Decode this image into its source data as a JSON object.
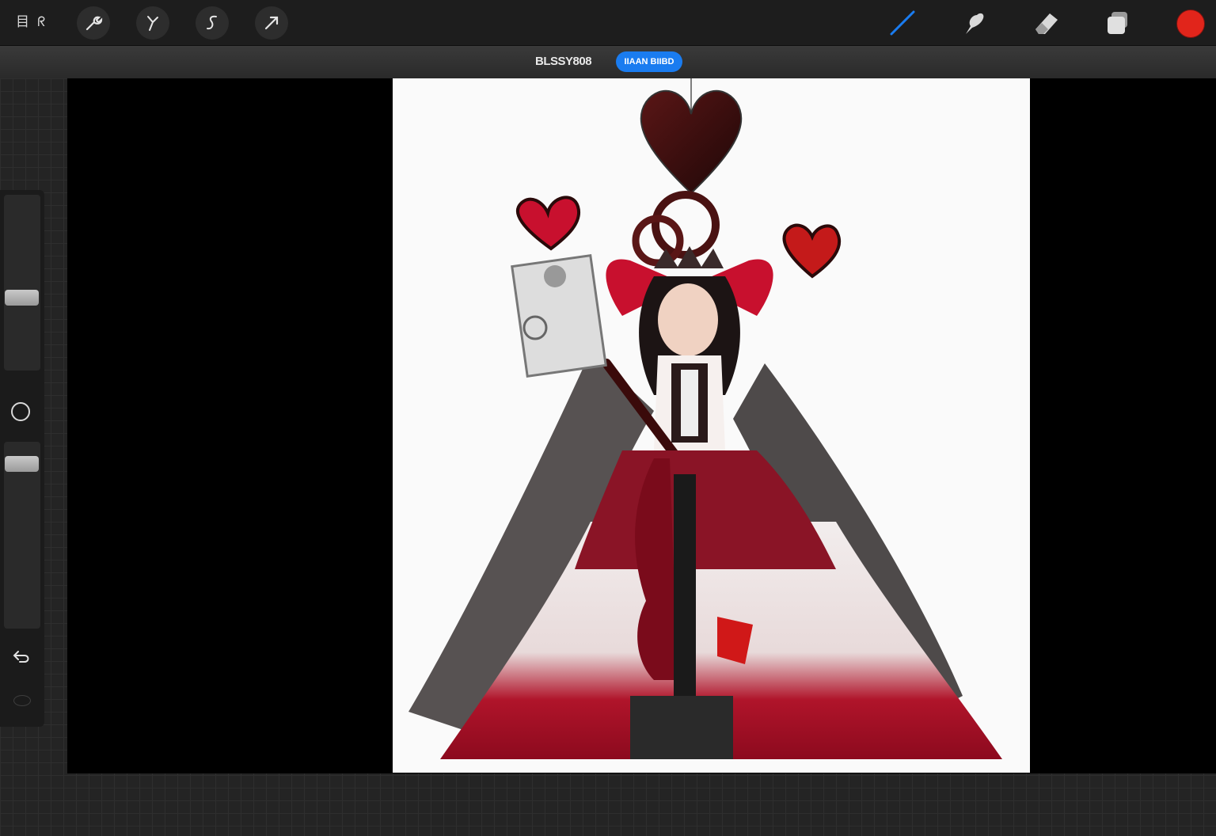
{
  "toolbar": {
    "gallery_label": "目 ᖇ",
    "tools": [
      {
        "name": "actions",
        "icon": "wrench-icon"
      },
      {
        "name": "adjustments",
        "icon": "magic-wand-icon"
      },
      {
        "name": "selection",
        "icon": "selection-s-icon"
      },
      {
        "name": "transform",
        "icon": "arrow-cursor-icon"
      }
    ],
    "right_tools": [
      {
        "name": "brush",
        "icon": "brush-icon",
        "active_color": "#1a7cf0"
      },
      {
        "name": "smudge",
        "icon": "smudge-icon"
      },
      {
        "name": "eraser",
        "icon": "eraser-icon"
      },
      {
        "name": "layers",
        "icon": "layers-icon"
      }
    ],
    "current_color": "#e1251b"
  },
  "document": {
    "title": "BLSSY808",
    "pill_label": "IIAAN BIIBD"
  },
  "sidebar": {
    "brush_size_level": 0.6,
    "opacity_level": 0.85,
    "undo_icon": "undo-icon",
    "redo_icon": "redo-icon"
  },
  "colors": {
    "accent_blue": "#1a7cf0",
    "heart_red": "#c8102e",
    "dark": "#2b0d0d"
  }
}
